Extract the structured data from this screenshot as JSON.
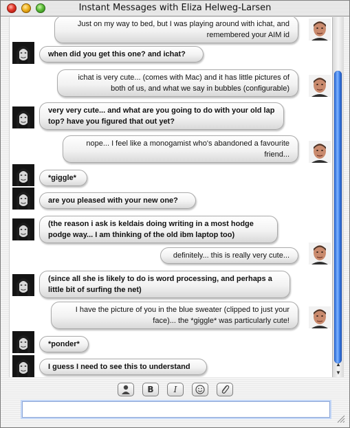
{
  "window": {
    "title": "Instant Messages with Eliza Helweg-Larsen"
  },
  "transcript": {
    "messages": [
      {
        "side": "right",
        "text": "Just on my way to bed, but I was playing around with ichat, and remembered your AIM id"
      },
      {
        "side": "left",
        "text": "when did you get this one? and ichat?"
      },
      {
        "side": "right",
        "text": "ichat is very cute... (comes with Mac) and it has little pictures of both of us, and what we say in bubbles (configurable)"
      },
      {
        "side": "left",
        "text": "very very cute... and what are you going to do with your old lap top? have you figured that out yet?"
      },
      {
        "side": "right",
        "text": "nope... I feel like a monogamist who's abandoned a favourite friend..."
      },
      {
        "side": "left",
        "text": "*giggle*"
      },
      {
        "side": "left",
        "text": "are you pleased with your new one?"
      },
      {
        "side": "left",
        "text": "(the reason i ask is keldais doing writing in a most hodge podge way... I am thinking of the old ibm laptop too)"
      },
      {
        "side": "right",
        "text": "definitely... this is really very cute..."
      },
      {
        "side": "left",
        "text": "(since all she is likely to do is word processing, and perhaps a little bit of surfing the net)"
      },
      {
        "side": "right",
        "text": "I have the picture of you in the blue sweater (clipped to just your face)... the *giggle* was particularly cute!"
      },
      {
        "side": "left",
        "text": "*ponder*"
      },
      {
        "side": "left",
        "text": "I guess I need to see this to understand"
      }
    ]
  },
  "toolbar": {
    "buttons": [
      {
        "icon": "person-icon",
        "label": "👤"
      },
      {
        "icon": "bold-icon",
        "label": "B"
      },
      {
        "icon": "italic-icon",
        "label": "I"
      },
      {
        "icon": "smiley-icon",
        "label": "☺"
      },
      {
        "icon": "paperclip-icon",
        "label": "📎"
      }
    ]
  },
  "input": {
    "value": ""
  },
  "colors": {
    "scroll_thumb": "#3d7fe8",
    "input_focus": "#c3d7f7"
  }
}
